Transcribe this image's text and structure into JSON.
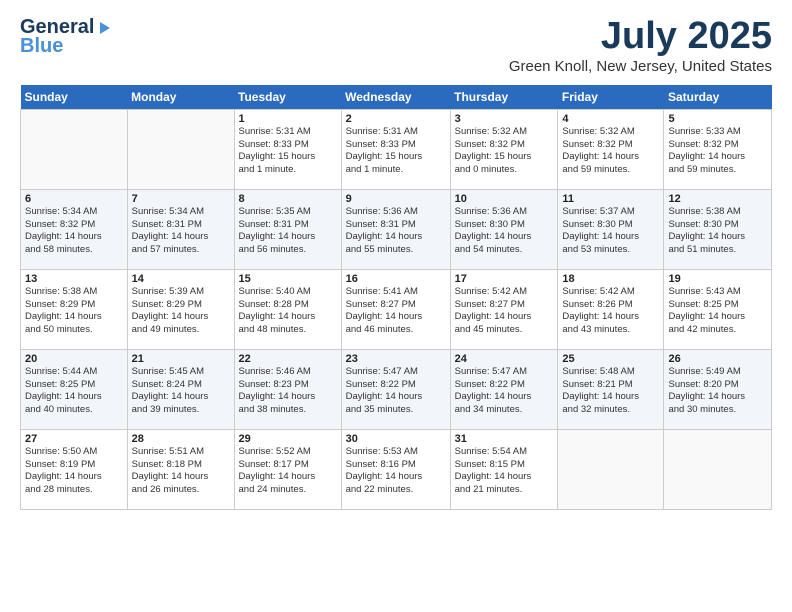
{
  "header": {
    "logo_line1": "General",
    "logo_line2": "Blue",
    "month": "July 2025",
    "location": "Green Knoll, New Jersey, United States"
  },
  "days_of_week": [
    "Sunday",
    "Monday",
    "Tuesday",
    "Wednesday",
    "Thursday",
    "Friday",
    "Saturday"
  ],
  "weeks": [
    [
      {
        "num": "",
        "info": ""
      },
      {
        "num": "",
        "info": ""
      },
      {
        "num": "1",
        "info": "Sunrise: 5:31 AM\nSunset: 8:33 PM\nDaylight: 15 hours\nand 1 minute."
      },
      {
        "num": "2",
        "info": "Sunrise: 5:31 AM\nSunset: 8:33 PM\nDaylight: 15 hours\nand 1 minute."
      },
      {
        "num": "3",
        "info": "Sunrise: 5:32 AM\nSunset: 8:32 PM\nDaylight: 15 hours\nand 0 minutes."
      },
      {
        "num": "4",
        "info": "Sunrise: 5:32 AM\nSunset: 8:32 PM\nDaylight: 14 hours\nand 59 minutes."
      },
      {
        "num": "5",
        "info": "Sunrise: 5:33 AM\nSunset: 8:32 PM\nDaylight: 14 hours\nand 59 minutes."
      }
    ],
    [
      {
        "num": "6",
        "info": "Sunrise: 5:34 AM\nSunset: 8:32 PM\nDaylight: 14 hours\nand 58 minutes."
      },
      {
        "num": "7",
        "info": "Sunrise: 5:34 AM\nSunset: 8:31 PM\nDaylight: 14 hours\nand 57 minutes."
      },
      {
        "num": "8",
        "info": "Sunrise: 5:35 AM\nSunset: 8:31 PM\nDaylight: 14 hours\nand 56 minutes."
      },
      {
        "num": "9",
        "info": "Sunrise: 5:36 AM\nSunset: 8:31 PM\nDaylight: 14 hours\nand 55 minutes."
      },
      {
        "num": "10",
        "info": "Sunrise: 5:36 AM\nSunset: 8:30 PM\nDaylight: 14 hours\nand 54 minutes."
      },
      {
        "num": "11",
        "info": "Sunrise: 5:37 AM\nSunset: 8:30 PM\nDaylight: 14 hours\nand 53 minutes."
      },
      {
        "num": "12",
        "info": "Sunrise: 5:38 AM\nSunset: 8:30 PM\nDaylight: 14 hours\nand 51 minutes."
      }
    ],
    [
      {
        "num": "13",
        "info": "Sunrise: 5:38 AM\nSunset: 8:29 PM\nDaylight: 14 hours\nand 50 minutes."
      },
      {
        "num": "14",
        "info": "Sunrise: 5:39 AM\nSunset: 8:29 PM\nDaylight: 14 hours\nand 49 minutes."
      },
      {
        "num": "15",
        "info": "Sunrise: 5:40 AM\nSunset: 8:28 PM\nDaylight: 14 hours\nand 48 minutes."
      },
      {
        "num": "16",
        "info": "Sunrise: 5:41 AM\nSunset: 8:27 PM\nDaylight: 14 hours\nand 46 minutes."
      },
      {
        "num": "17",
        "info": "Sunrise: 5:42 AM\nSunset: 8:27 PM\nDaylight: 14 hours\nand 45 minutes."
      },
      {
        "num": "18",
        "info": "Sunrise: 5:42 AM\nSunset: 8:26 PM\nDaylight: 14 hours\nand 43 minutes."
      },
      {
        "num": "19",
        "info": "Sunrise: 5:43 AM\nSunset: 8:25 PM\nDaylight: 14 hours\nand 42 minutes."
      }
    ],
    [
      {
        "num": "20",
        "info": "Sunrise: 5:44 AM\nSunset: 8:25 PM\nDaylight: 14 hours\nand 40 minutes."
      },
      {
        "num": "21",
        "info": "Sunrise: 5:45 AM\nSunset: 8:24 PM\nDaylight: 14 hours\nand 39 minutes."
      },
      {
        "num": "22",
        "info": "Sunrise: 5:46 AM\nSunset: 8:23 PM\nDaylight: 14 hours\nand 38 minutes."
      },
      {
        "num": "23",
        "info": "Sunrise: 5:47 AM\nSunset: 8:22 PM\nDaylight: 14 hours\nand 35 minutes."
      },
      {
        "num": "24",
        "info": "Sunrise: 5:47 AM\nSunset: 8:22 PM\nDaylight: 14 hours\nand 34 minutes."
      },
      {
        "num": "25",
        "info": "Sunrise: 5:48 AM\nSunset: 8:21 PM\nDaylight: 14 hours\nand 32 minutes."
      },
      {
        "num": "26",
        "info": "Sunrise: 5:49 AM\nSunset: 8:20 PM\nDaylight: 14 hours\nand 30 minutes."
      }
    ],
    [
      {
        "num": "27",
        "info": "Sunrise: 5:50 AM\nSunset: 8:19 PM\nDaylight: 14 hours\nand 28 minutes."
      },
      {
        "num": "28",
        "info": "Sunrise: 5:51 AM\nSunset: 8:18 PM\nDaylight: 14 hours\nand 26 minutes."
      },
      {
        "num": "29",
        "info": "Sunrise: 5:52 AM\nSunset: 8:17 PM\nDaylight: 14 hours\nand 24 minutes."
      },
      {
        "num": "30",
        "info": "Sunrise: 5:53 AM\nSunset: 8:16 PM\nDaylight: 14 hours\nand 22 minutes."
      },
      {
        "num": "31",
        "info": "Sunrise: 5:54 AM\nSunset: 8:15 PM\nDaylight: 14 hours\nand 21 minutes."
      },
      {
        "num": "",
        "info": ""
      },
      {
        "num": "",
        "info": ""
      }
    ]
  ]
}
